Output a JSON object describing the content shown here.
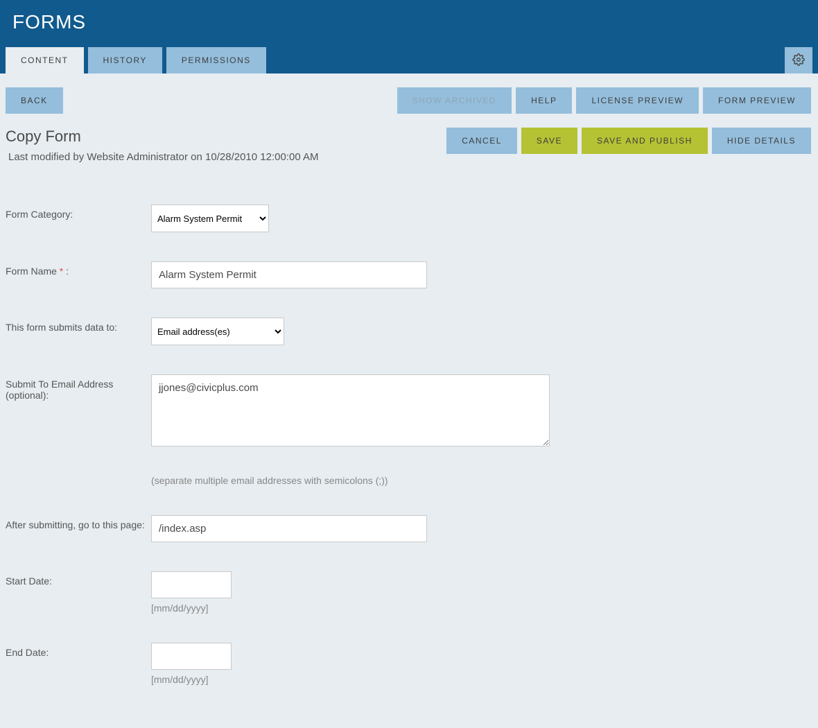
{
  "header": {
    "title": "FORMS"
  },
  "tabs": {
    "content": "CONTENT",
    "history": "HISTORY",
    "permissions": "PERMISSIONS"
  },
  "toolbar": {
    "back": "BACK",
    "show_archived": "SHOW ARCHIVED",
    "help": "HELP",
    "license_preview": "LICENSE PREVIEW",
    "form_preview": "FORM PREVIEW",
    "cancel": "CANCEL",
    "save": "SAVE",
    "save_publish": "SAVE AND PUBLISH",
    "hide_details": "HIDE DETAILS"
  },
  "page": {
    "title": "Copy Form",
    "last_modified": "Last modified by Website Administrator on 10/28/2010 12:00:00 AM"
  },
  "form": {
    "category_label": "Form Category:",
    "category_value": "Alarm System Permit",
    "name_label": "Form Name ",
    "name_required": "*",
    "name_colon": " :",
    "name_value": "Alarm System Permit",
    "submits_to_label": "This form submits data to:",
    "submits_to_value": "Email address(es)",
    "submit_email_label": "Submit To Email Address (optional):",
    "submit_email_value": "jjones@civicplus.com",
    "submit_email_hint": "(separate multiple email addresses with semicolons (;))",
    "after_submit_label": "After submitting, go to this page:",
    "after_submit_value": "/index.asp",
    "start_date_label": "Start Date:",
    "start_date_value": "",
    "date_hint": "[mm/dd/yyyy]",
    "end_date_label": "End Date:",
    "end_date_value": ""
  }
}
